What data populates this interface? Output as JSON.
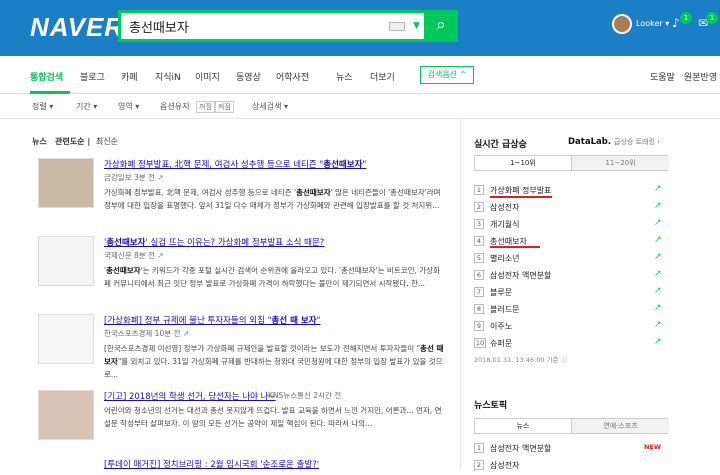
{
  "header": {
    "logo": "NAVER",
    "search_value": "총선때보자",
    "search_button": "⌕",
    "user_name": "Looker ▾",
    "bell_count": "1",
    "mail_count": "1"
  },
  "nav": {
    "tabs": [
      "통합검색",
      "블로그",
      "카페",
      "지식iN",
      "이미지",
      "동영상",
      "어학사전",
      "뉴스",
      "더보기"
    ],
    "options_label": "검색옵션 ^",
    "right_links": [
      "도움말",
      "원본반영"
    ]
  },
  "filters": {
    "items": [
      "정렬 ▾",
      "기간 ▾",
      "영역 ▾",
      "옵션유지",
      "상세검색 ▾"
    ],
    "pill_on": "꺼짐",
    "pill_off": "켜짐"
  },
  "news_sub": {
    "a": "뉴스",
    "b": "관련도순",
    "c": "최신순"
  },
  "results": [
    {
      "title_pre": "가상화폐 정부발표, 北핵 문제, 여검사 성추행 등으로 네티즌 \"",
      "title_hl": "총선때보자",
      "title_post": "\"",
      "meta": "금강일보 3분 전",
      "desc_1": "가상화폐 정부발표, 北핵 문제, 여검사 성추행 등으로 네티즌 '",
      "desc_hl": "총선때보자",
      "desc_2": "' 많은 네티즌들이 '총선때보자'라며 정부에 대한 입장을 표명했다. 앞서 31일 다수 매체가 정부가 가상화폐와 관련해 입장발표를 할 것 처지위..."
    },
    {
      "title_pre": "'",
      "title_hl": "총선때보자",
      "title_post": "' 실검 뜨는 이유는? 가상화폐 정부발표 소식 때문?",
      "meta": "국제신문 8분 전",
      "desc_1": "'",
      "desc_hl": "총선때보자",
      "desc_2": "'는 키워드가 각종 포털 실시간 검색어 순위권에 올라오고 있다. '총선때보자'는 비트코인, 가상화폐 커뮤니티에서 최근 잇단 정부 발표로 가상화폐 가격이 하락했다는 불만이 제기되면서 시작됐다. 한..."
    },
    {
      "title_pre": "[가상화폐] 정부 규제에 불난 투자자들의 외침 \"",
      "title_hl": "총선 때 보자",
      "title_post": "\"",
      "meta": "한국스포츠경제 10분 전",
      "desc_1": "[한국스포츠경제 이선영] 정부가 가상화폐 규제안을 발표할 것이라는 보도가 전해지면서 투자자들이 \"",
      "desc_hl": "총선 때 보자",
      "desc_2": "\"를 외치고 있다. 31일 가상화폐 규제를 반대하는 청와대 국민청원에 대한 정부의 입장 발표가 있을 것으로..."
    },
    {
      "title_pre": "[기고] 2018년의 학생 선거, 당선자는 나야 나~",
      "title_hl": "",
      "title_post": "",
      "meta": "KNS뉴스통신 2시간 전",
      "desc_1": "어린이와 청소년의 선거는 대선과 총선 못지않게 뜨겁다. 발표 교육을 하면서 느낀 거지만, 어른과... 먼저, 연설문 작성부터 살펴보자. 이 땅의 모든 선거는 공약이 제일 핵심이 된다. 따라서 나의...",
      "desc_hl": "",
      "desc_2": ""
    },
    {
      "title_pre": "[투데이 매거진] 정치브리핑 : 2월 임시국회 '순조로운 출발?'",
      "title_hl": "",
      "title_post": "",
      "meta": "",
      "desc_1": "",
      "desc_hl": "",
      "desc_2": ""
    }
  ],
  "realtime": {
    "title": "실시간 급상승",
    "datalab": "DataLab.",
    "datalab_sub": "급상승 트래킹 ›",
    "tab_a": "1~10위",
    "tab_b": "11~20위",
    "items": [
      {
        "rank": "1",
        "word": "가상화폐 정부발표"
      },
      {
        "rank": "2",
        "word": "삼성전자"
      },
      {
        "rank": "3",
        "word": "개기월식"
      },
      {
        "rank": "4",
        "word": "총선때보자"
      },
      {
        "rank": "5",
        "word": "별리소년"
      },
      {
        "rank": "6",
        "word": "삼성전자 액면분할"
      },
      {
        "rank": "7",
        "word": "블루문"
      },
      {
        "rank": "8",
        "word": "블러드문"
      },
      {
        "rank": "9",
        "word": "이주노"
      },
      {
        "rank": "10",
        "word": "슈퍼문"
      }
    ],
    "timestamp": "2018.01.31. 13:46:00 기준 ⓘ"
  },
  "newstopic": {
    "title": "뉴스토픽",
    "tab_a": "뉴스",
    "tab_b": "연예·스포츠",
    "items": [
      {
        "rank": "1",
        "word": "삼성전자 액면분할",
        "badge": "NEW"
      },
      {
        "rank": "2",
        "word": "삼성전자",
        "badge": ""
      }
    ]
  },
  "colors": {
    "brand": "#03c75a",
    "header": "#1a7fc4",
    "highlight": "#e02020"
  }
}
